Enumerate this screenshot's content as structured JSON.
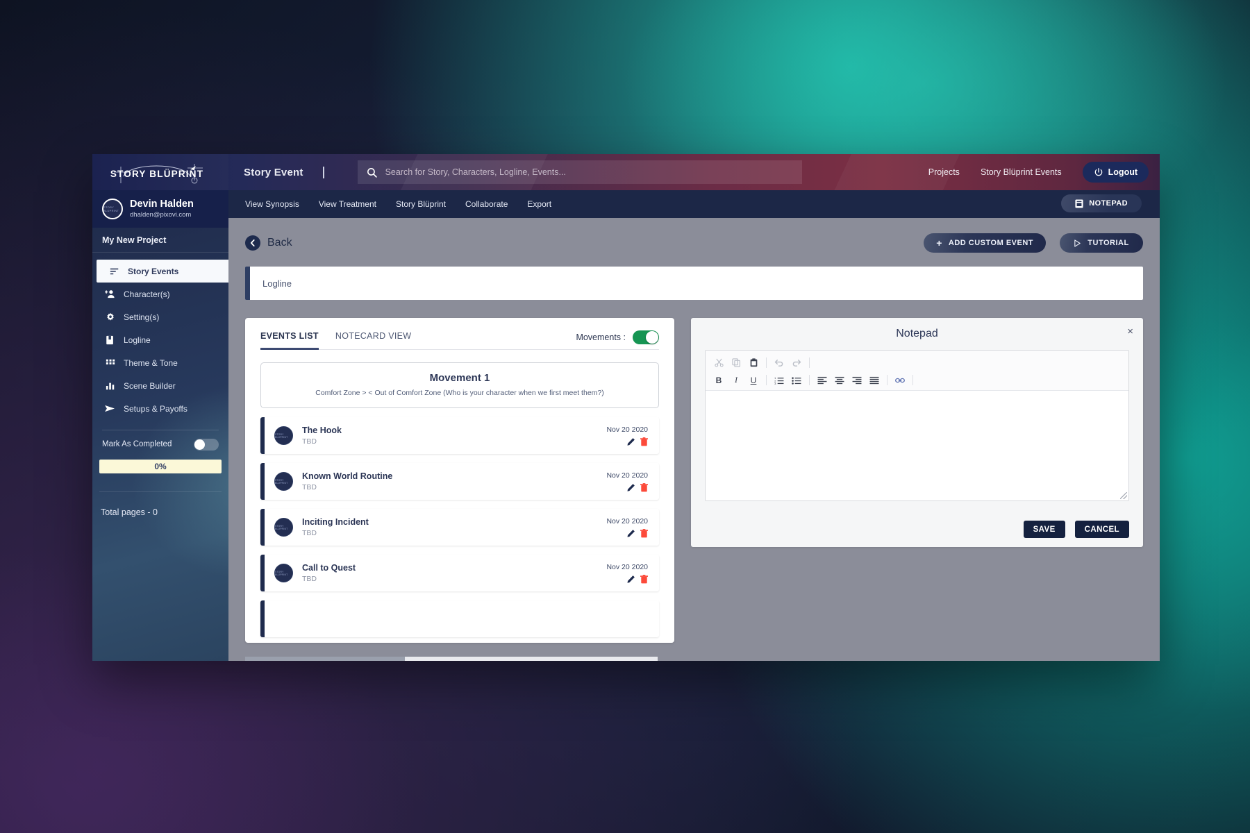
{
  "topbar": {
    "logo_text": "STORY BLÜPRINT",
    "title": "Story Event",
    "search_placeholder": "Search for Story, Characters, Logline, Events...",
    "search_value": "",
    "links": [
      "Projects",
      "Story Blüprint Events"
    ],
    "logout_label": "Logout"
  },
  "sidebar": {
    "user": {
      "name": "Devin Halden",
      "email": "dhalden@pixovi.com"
    },
    "project": "My New Project",
    "items": [
      {
        "label": "Story Events",
        "icon": "list-icon",
        "active": true
      },
      {
        "label": "Character(s)",
        "icon": "person-add-icon",
        "active": false
      },
      {
        "label": "Setting(s)",
        "icon": "gear-icon",
        "active": false
      },
      {
        "label": "Logline",
        "icon": "book-icon",
        "active": false
      },
      {
        "label": "Theme & Tone",
        "icon": "grid-icon",
        "active": false
      },
      {
        "label": "Scene Builder",
        "icon": "bar-chart-icon",
        "active": false
      },
      {
        "label": "Setups & Payoffs",
        "icon": "send-icon",
        "active": false
      }
    ],
    "mark_as_completed_label": "Mark As Completed",
    "mark_as_completed_state": "off",
    "progress_text": "0%",
    "progress_percent": 0,
    "total_pages_label": "Total pages - 0"
  },
  "subnav": {
    "items": [
      "View Synopsis",
      "View Treatment",
      "Story Blüprint",
      "Collaborate",
      "Export"
    ],
    "notepad_button": "NOTEPAD"
  },
  "content": {
    "back_label": "Back",
    "add_custom_event_label": "ADD CUSTOM EVENT",
    "tutorial_label": "TUTORIAL",
    "logline_label": "Logline"
  },
  "events": {
    "tabs": [
      {
        "label": "EVENTS LIST",
        "active": true
      },
      {
        "label": "NOTECARD VIEW",
        "active": false
      }
    ],
    "movements_label": "Movements :",
    "movements_state": "on",
    "movement": {
      "title": "Movement 1",
      "subtitle": "Comfort Zone > < Out of Comfort Zone (Who is your character when we first meet them?)"
    },
    "rows": [
      {
        "title": "The Hook",
        "status": "TBD",
        "date": "Nov 20 2020"
      },
      {
        "title": "Known World Routine",
        "status": "TBD",
        "date": "Nov 20 2020"
      },
      {
        "title": "Inciting Incident",
        "status": "TBD",
        "date": "Nov 20 2020"
      },
      {
        "title": "Call to Quest",
        "status": "TBD",
        "date": "Nov 20 2020"
      }
    ]
  },
  "notepad": {
    "title": "Notepad",
    "close_label": "×",
    "body_value": "",
    "toolbar_row1": [
      "cut-icon",
      "copy-icon",
      "paste-icon",
      "undo-icon",
      "redo-icon"
    ],
    "toolbar_row2": [
      "bold-icon",
      "italic-icon",
      "underline-icon",
      "numbered-list-icon",
      "bullet-list-icon",
      "align-left-icon",
      "align-center-icon",
      "align-right-icon",
      "align-justify-icon",
      "link-icon"
    ],
    "bold_label": "B",
    "italic_label": "I",
    "underline_label": "U",
    "save_label": "SAVE",
    "cancel_label": "CANCEL"
  },
  "colors": {
    "accent_navy": "#1f2b4d",
    "toggle_green": "#169553",
    "delete_red": "#fc4a3a",
    "progress_yellow": "#fbf8d8"
  }
}
